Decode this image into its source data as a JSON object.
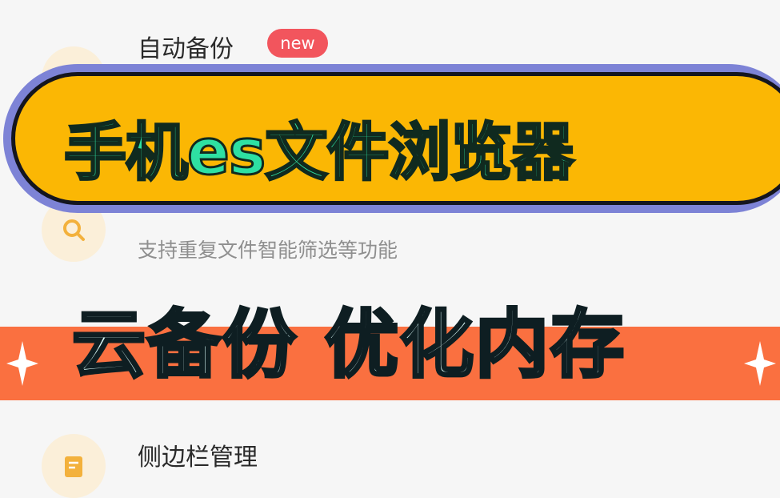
{
  "list": {
    "backup": {
      "title": "自动备份",
      "badge": "new"
    },
    "clean": {
      "desc": "支持重复文件智能筛选等功能"
    },
    "sidebar": {
      "title": "侧边栏管理"
    }
  },
  "overlay": {
    "headline": "手机es文件浏览器",
    "subline": "云备份 优化内存"
  },
  "colors": {
    "banner_fill": "#fbb704",
    "banner_ring": "#7d83d6",
    "headline": "#2ee0a2",
    "subline": "#d9f8f6",
    "stripe": "#fa7040",
    "badge": "#f2555d"
  }
}
